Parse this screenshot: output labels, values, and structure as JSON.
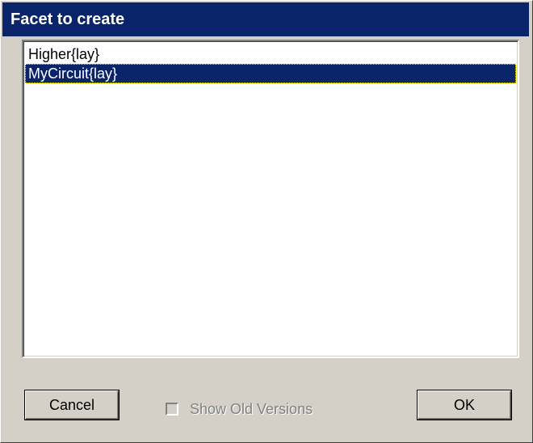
{
  "dialog": {
    "title": "Facet to create"
  },
  "list": {
    "items": [
      {
        "label": "Higher{lay}",
        "selected": false
      },
      {
        "label": "MyCircuit{lay}",
        "selected": true
      }
    ]
  },
  "buttons": {
    "cancel_label": "Cancel",
    "ok_label": "OK"
  },
  "checkbox": {
    "label": "Show Old Versions",
    "checked": false,
    "enabled": false
  },
  "colors": {
    "title_bar": "#0a246a",
    "selection": "#0a246a",
    "face": "#d4d0c8"
  }
}
